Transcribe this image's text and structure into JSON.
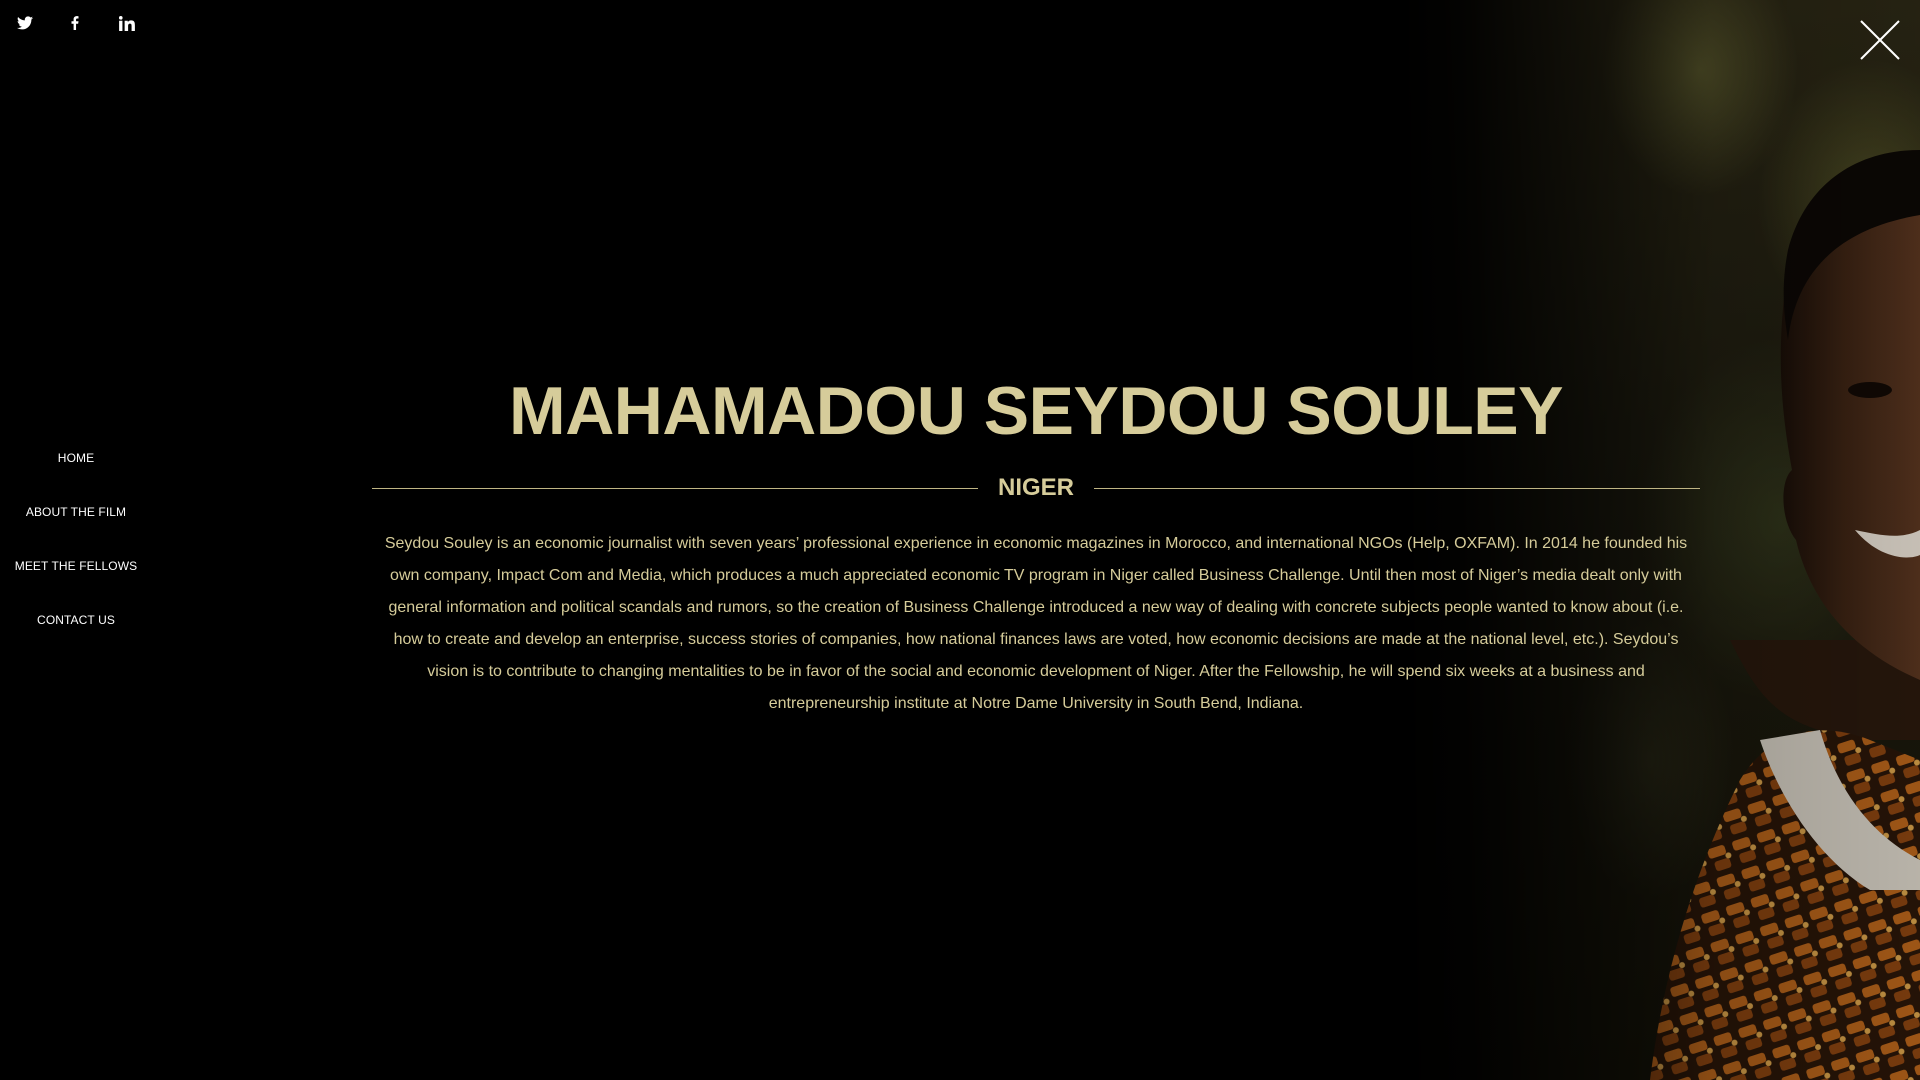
{
  "social": [
    {
      "name": "twitter-icon",
      "label": "Twitter"
    },
    {
      "name": "facebook-icon",
      "label": "Facebook"
    },
    {
      "name": "linkedin-icon",
      "label": "LinkedIn"
    }
  ],
  "nav": {
    "items": [
      {
        "label": "HOME"
      },
      {
        "label": "ABOUT THE FILM"
      },
      {
        "label": "MEET THE FELLOWS"
      },
      {
        "label": "CONTACT US"
      }
    ]
  },
  "fellow": {
    "name": "MAHAMADOU SEYDOU SOULEY",
    "country": "NIGER",
    "bio": "Seydou Souley is an economic journalist with seven years’ professional experience in economic magazines in Morocco, and international NGOs (Help, OXFAM). In 2014 he founded his own company, Impact Com and Media, which produces a much appreciated economic TV program in Niger called Business Challenge. Until then most of Niger’s media dealt only with general information and political scandals and rumors, so the creation of Business Challenge introduced a new way of dealing with concrete subjects people wanted to know about (i.e. how to create and develop an enterprise, success stories of companies, how national finances laws are voted, how economic decisions are made at the national level, etc.). Seydou’s vision is to contribute to changing mentalities to be in favor of the social and economic development of Niger. After the Fellowship, he will spend six weeks at a business and entrepreneurship institute at Notre Dame University in South Bend, Indiana."
  },
  "colors": {
    "background": "#000000",
    "accent_text": "#d6cc9a",
    "nav_text": "#ffffff"
  }
}
